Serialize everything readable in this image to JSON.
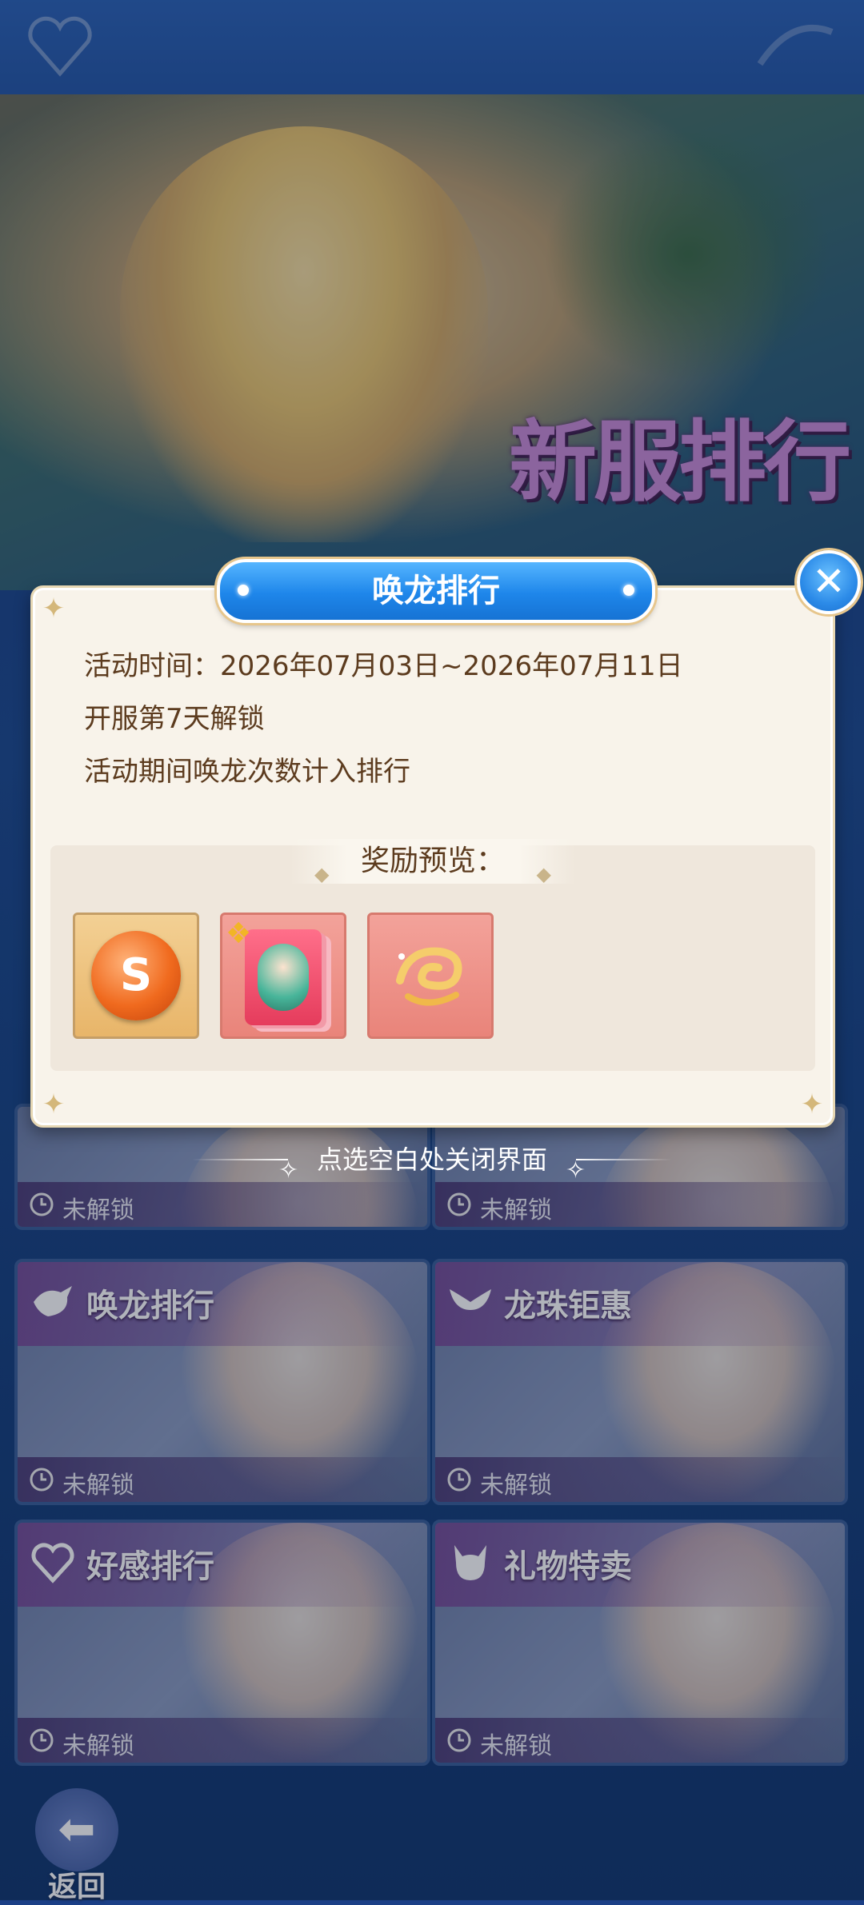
{
  "banner": {
    "title": "新服排行"
  },
  "dialog": {
    "title": "唤龙排行",
    "info_lines": [
      "活动时间：2026年07月03日~2026年07月11日",
      "开服第7天解锁",
      "活动期间唤龙次数计入排行"
    ],
    "reward_label": "奖励预览：",
    "rewards": [
      {
        "icon": "dragon-orb-icon"
      },
      {
        "icon": "character-card-fragment-icon"
      },
      {
        "icon": "golden-dragon-icon"
      }
    ],
    "close_hint": "点选空白处关闭界面"
  },
  "cards": [
    {
      "name": "",
      "status": "未解锁"
    },
    {
      "name": "",
      "status": "未解锁"
    },
    {
      "name": "唤龙排行",
      "status": "未解锁"
    },
    {
      "name": "龙珠钜惠",
      "status": "未解锁"
    },
    {
      "name": "好感排行",
      "status": "未解锁"
    },
    {
      "name": "礼物特卖",
      "status": "未解锁"
    }
  ],
  "footer": {
    "back_label": "返回"
  },
  "colors": {
    "dialog_bg": "#f8f3ea",
    "title_blue": "#1e86ea",
    "text_brown": "#5c3b1e"
  }
}
